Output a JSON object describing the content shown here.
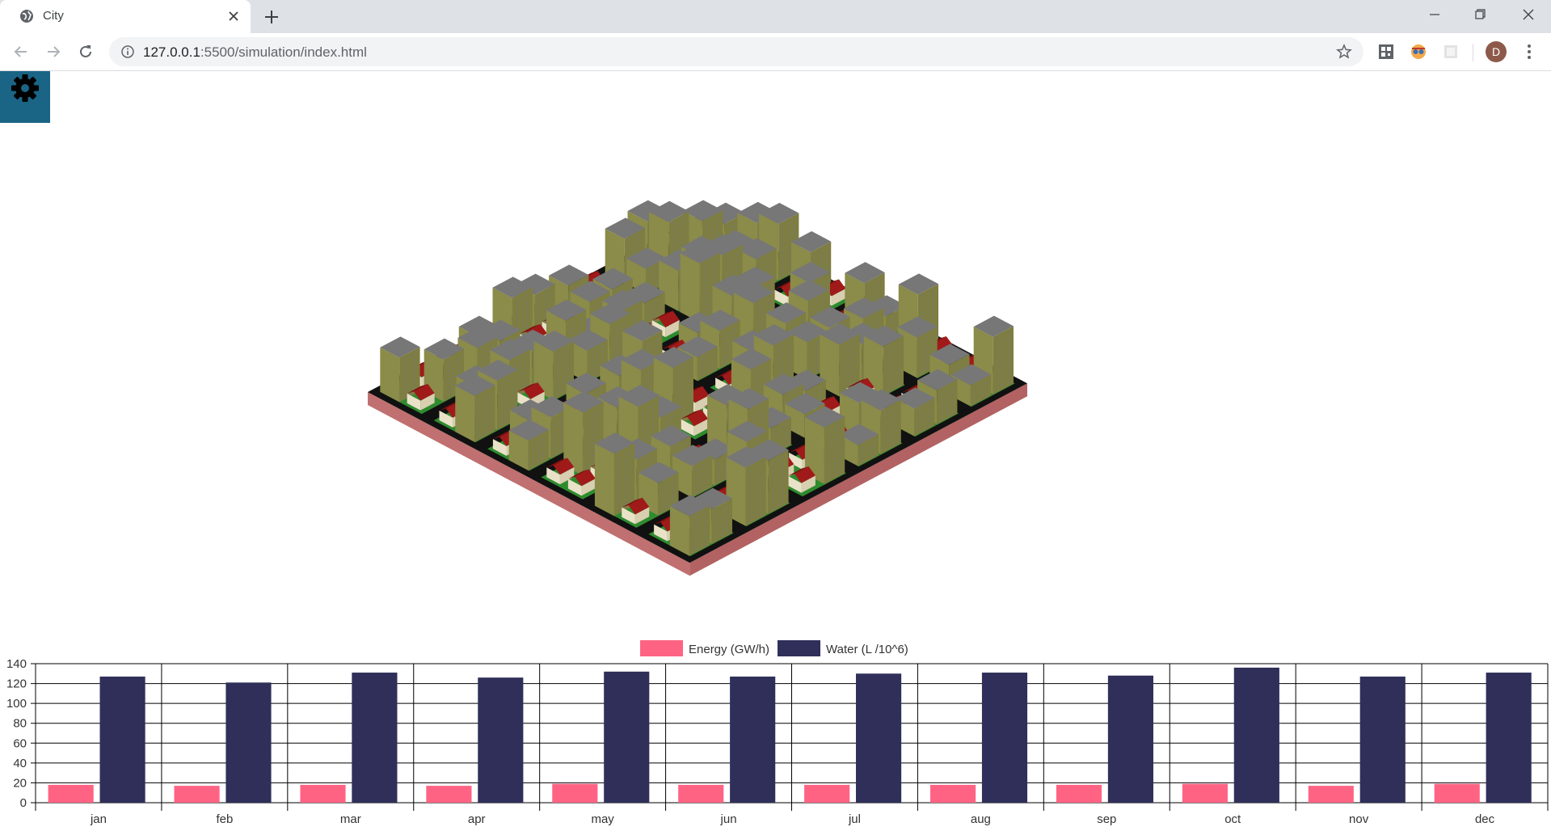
{
  "browser": {
    "tab_title": "City",
    "url_host": "127.0.0.1",
    "url_rest": ":5500/simulation/index.html",
    "avatar_letter": "D"
  },
  "page": {
    "settings_icon": "gear-icon",
    "accent": "#1a6585",
    "city_colors": {
      "base": "#c07070",
      "ground": "#111111",
      "roof": "#777777",
      "wall": "#8b8b4a",
      "house_roof": "#a01a1a",
      "grass": "#2e8b2e"
    }
  },
  "chart_data": {
    "type": "bar",
    "title": "",
    "xlabel": "",
    "ylabel": "",
    "categories": [
      "jan",
      "feb",
      "mar",
      "apr",
      "may",
      "jun",
      "jul",
      "aug",
      "sep",
      "oct",
      "nov",
      "dec"
    ],
    "ylim": [
      0,
      140
    ],
    "yticks": [
      0,
      20,
      40,
      60,
      80,
      100,
      120,
      140
    ],
    "grid": true,
    "legend_placement": "top-center",
    "series": [
      {
        "name": "Energy (GW/h)",
        "color": "#ff6384",
        "values": [
          18,
          17,
          18,
          17,
          19,
          18,
          18,
          18,
          18,
          19,
          17,
          19
        ]
      },
      {
        "name": "Water (L /10^6)",
        "color": "#2f2f5a",
        "values": [
          127,
          121,
          131,
          126,
          132,
          127,
          130,
          131,
          128,
          136,
          127,
          131
        ]
      }
    ]
  }
}
